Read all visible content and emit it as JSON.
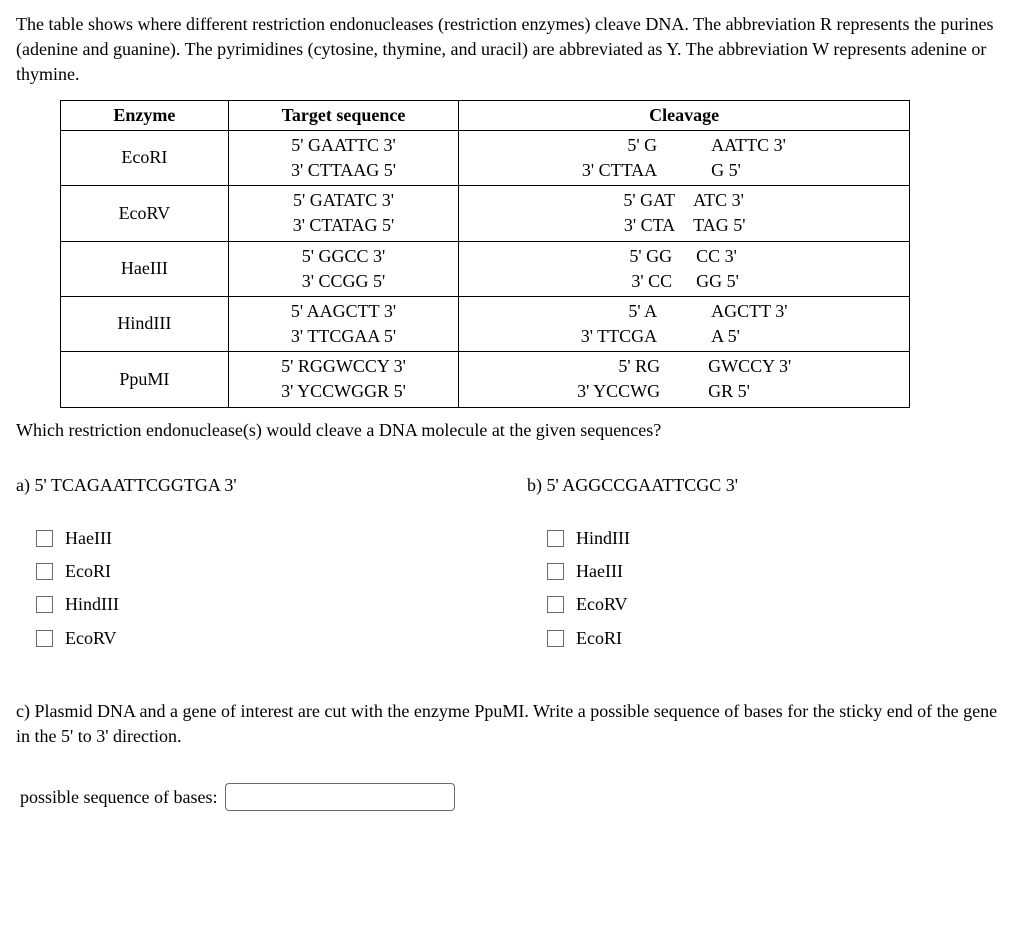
{
  "intro": "The table shows where different restriction endonucleases (restriction enzymes) cleave DNA. The abbreviation R represents the purines (adenine and guanine). The pyrimidines (cytosine, thymine, and uracil) are abbreviated as Y. The abbreviation W represents adenine or thymine.",
  "headers": {
    "enzyme": "Enzyme",
    "target": "Target sequence",
    "cleavage": "Cleavage"
  },
  "rows": [
    {
      "enzyme": "EcoRI",
      "target_top": "5' GAATTC 3'",
      "target_bot": "3' CTTAAG 5'",
      "cl_top_left": "5' G",
      "cl_top_right": "AATTC 3'",
      "cl_bot_left": "3' CTTAA",
      "cl_bot_right": "G 5'",
      "lw": "92px",
      "gw": "54px",
      "rw": "92px"
    },
    {
      "enzyme": "EcoRV",
      "target_top": "5' GATATC 3'",
      "target_bot": "3' CTATAG 5'",
      "cl_top_left": "5' GAT",
      "cl_top_right": "ATC 3'",
      "cl_bot_left": "3' CTA",
      "cl_bot_right": "TAG 5'",
      "lw": "70px",
      "gw": "18px",
      "rw": "70px"
    },
    {
      "enzyme": "HaeIII",
      "target_top": "5' GGCC 3'",
      "target_bot": "3' CCGG 5'",
      "cl_top_left": "5' GG",
      "cl_top_right": "CC 3'",
      "cl_bot_left": "3' CC",
      "cl_bot_right": "GG 5'",
      "lw": "58px",
      "gw": "24px",
      "rw": "58px"
    },
    {
      "enzyme": "HindIII",
      "target_top": "5' AAGCTT 3'",
      "target_bot": "3' TTCGAA 5'",
      "cl_top_left": "5' A",
      "cl_top_right": "AGCTT 3'",
      "cl_bot_left": "3' TTCGA",
      "cl_bot_right": "A 5'",
      "lw": "92px",
      "gw": "54px",
      "rw": "92px"
    },
    {
      "enzyme": "PpuMI",
      "target_top": "5' RGGWCCY 3'",
      "target_bot": "3' YCCWGGR 5'",
      "cl_top_left": "5' RG",
      "cl_top_right": "GWCCY 3'",
      "cl_bot_left": "3' YCCWG",
      "cl_bot_right": "GR 5'",
      "lw": "104px",
      "gw": "48px",
      "rw": "104px"
    }
  ],
  "question": "Which restriction endonuclease(s) would cleave a DNA molecule at the given sequences?",
  "part_a": {
    "label": "a) 5' TCAGAATTCGGTGA 3'",
    "options": [
      "HaeIII",
      "EcoRI",
      "HindIII",
      "EcoRV"
    ]
  },
  "part_b": {
    "label": "b) 5' AGGCCGAATTCGC 3'",
    "options": [
      "HindIII",
      "HaeIII",
      "EcoRV",
      "EcoRI"
    ]
  },
  "part_c": {
    "text": "c) Plasmid DNA and a gene of interest are cut with the enzyme PpuMI. Write a possible sequence of bases for the sticky end of the gene in the 5' to 3' direction.",
    "input_label": "possible sequence of bases:"
  }
}
